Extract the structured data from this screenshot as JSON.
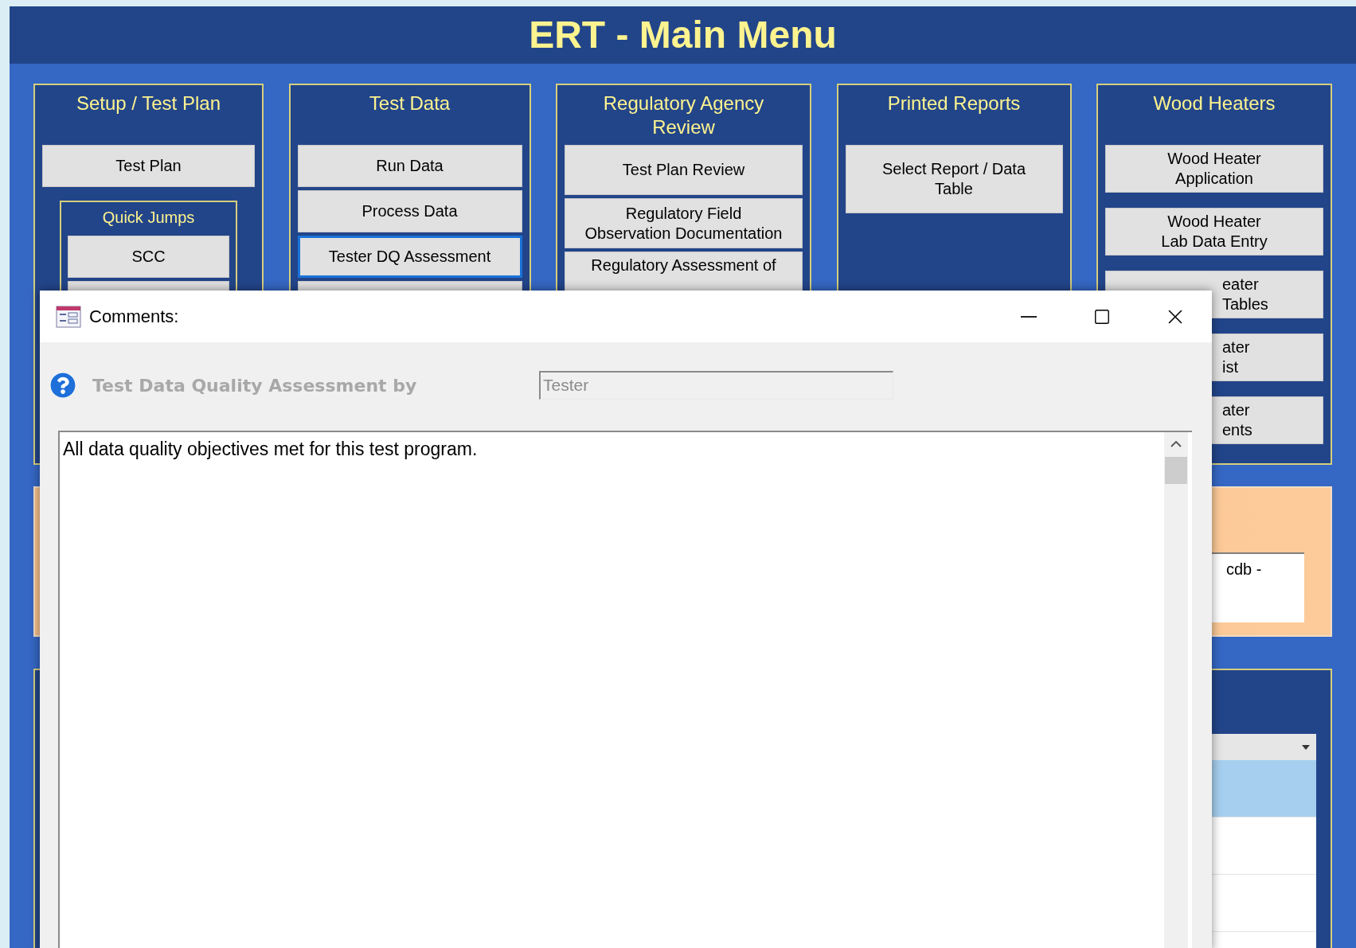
{
  "main_window": {
    "title": "ERT - Main Menu"
  },
  "panels": [
    {
      "title": "Setup / Test Plan",
      "buttons": [
        {
          "lines": [
            "Test Plan"
          ],
          "selected": false
        }
      ],
      "quick_jumps": {
        "title": "Quick Jumps",
        "buttons": [
          {
            "lines": [
              "SCC"
            ],
            "selected": false
          }
        ]
      }
    },
    {
      "title": "Test Data",
      "buttons": [
        {
          "lines": [
            "Run Data"
          ],
          "selected": false
        },
        {
          "lines": [
            "Process Data"
          ],
          "selected": false
        },
        {
          "lines": [
            "Tester DQ Assessment"
          ],
          "selected": true
        }
      ]
    },
    {
      "title": "Regulatory Agency Review",
      "buttons": [
        {
          "lines": [
            "Test Plan Review"
          ],
          "selected": false
        },
        {
          "lines": [
            "Regulatory Field",
            "Observation Documentation"
          ],
          "selected": false
        },
        {
          "lines": [
            "Regulatory Assessment of"
          ],
          "selected": false
        }
      ]
    },
    {
      "title": "Printed Reports",
      "buttons": [
        {
          "lines": [
            "Select Report / Data",
            "Table"
          ],
          "selected": false
        }
      ]
    },
    {
      "title": "Wood Heaters",
      "buttons": [
        {
          "lines": [
            "Wood Heater",
            "Application"
          ],
          "selected": false
        },
        {
          "lines": [
            "Wood Heater",
            "Lab Data Entry"
          ],
          "selected": false
        },
        {
          "lines": [
            "eater",
            "Tables"
          ],
          "selected": false
        },
        {
          "lines": [
            "ater",
            "ist"
          ],
          "selected": false
        },
        {
          "lines": [
            "ater",
            "ents"
          ],
          "selected": false
        }
      ]
    }
  ],
  "info_panel": {
    "field_value": "cdb -"
  },
  "list_panel": {
    "rows": [
      {
        "selected": true
      },
      {
        "selected": false
      },
      {
        "selected": false
      }
    ]
  },
  "dialog": {
    "title": "Comments:",
    "label": "Test Data Quality Assessment by",
    "assessed_by": {
      "value": "Tester",
      "disabled": true
    },
    "comment": "All data quality objectives met for this test program."
  }
}
